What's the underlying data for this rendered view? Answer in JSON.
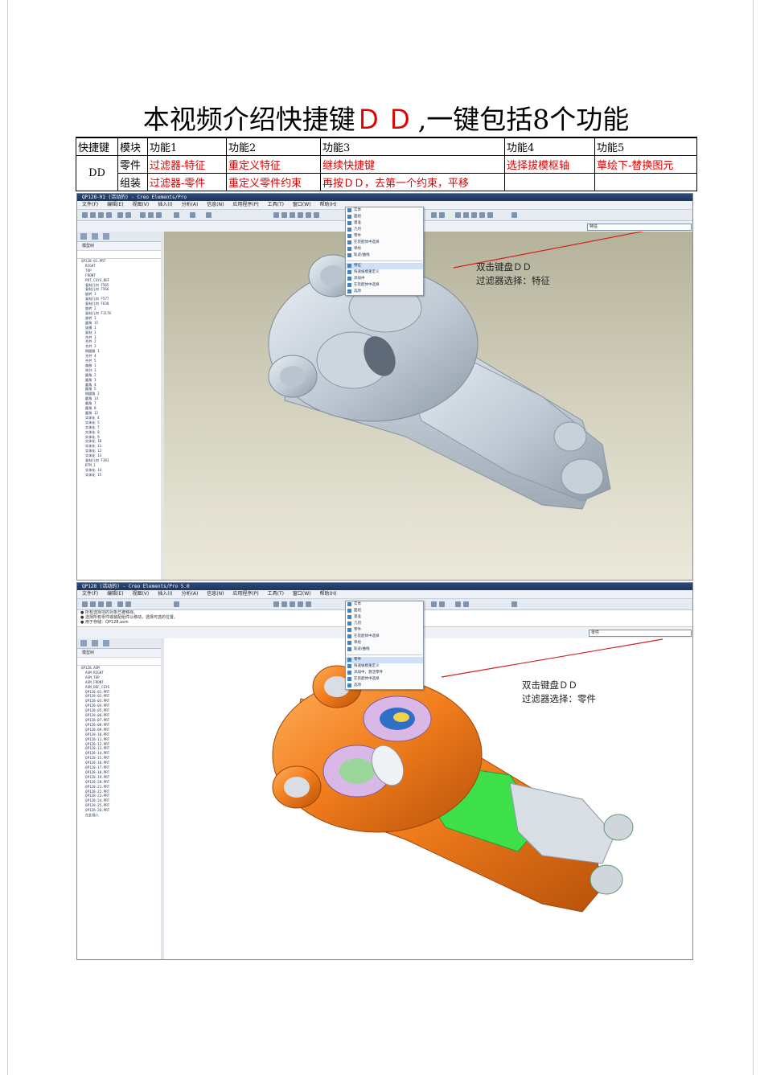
{
  "page": {
    "title_before": "本视频介绍快捷键",
    "title_dd": "ＤＤ",
    "title_after": ",一键包括8个功能"
  },
  "table": {
    "headers": [
      "快捷键",
      "模块",
      "功能1",
      "功能2",
      "功能3",
      "功能4",
      "功能5"
    ],
    "key": "DD",
    "rows": [
      {
        "module": "零件",
        "f1": "过滤器-特征",
        "f2": "重定义特征",
        "f3": "继续快捷键",
        "f4": "选择拔模枢轴",
        "f5": "草绘下-替换图元"
      },
      {
        "module": "组装",
        "f1": "过滤器-零件",
        "f2": "重定义零件约束",
        "f3": "再按ＤＤ，去第一个约束，平移",
        "f4": "",
        "f5": ""
      }
    ],
    "text_color": "#e00000"
  },
  "screenshot1": {
    "window_title": "QP128-01 (活动的) - Creo Elements/Pro",
    "menus": [
      "文件(F)",
      "编辑(E)",
      "视图(V)",
      "插入(I)",
      "分析(A)",
      "信息(N)",
      "应用程序(P)",
      "工具(T)",
      "窗口(W)",
      "帮助(H)"
    ],
    "filter_value": "特征",
    "tree_header": "模型树",
    "tree_root": "QP128-01.PRT",
    "tree_items": [
      "RIGHT",
      "TOP",
      "FRONT",
      "PRT_CSYS_DEF",
      "复制几何 F565",
      "复制几何 F566",
      "旋转 1",
      "复制几何 F577",
      "复制几何 F630",
      "旋转 2",
      "复制几何 F1178",
      "旋转 3",
      "圆角 15",
      "拔模 1",
      "复制 1",
      "合并 1",
      "合并 2",
      "合并 3",
      "倒圆角 1",
      "合并 4",
      "合并 5",
      "偏移 1",
      "阵列 1",
      "圆角 2",
      "圆角 3",
      "圆角 4",
      "圆角 5",
      "倒圆角 2",
      "圆角 14",
      "圆角 7",
      "圆角 8",
      "圆角 12",
      "实体化 4",
      "实体化 5",
      "实体化 7",
      "实体化 8",
      "实体化 9",
      "实体化 10",
      "实体化 11",
      "实体化 12",
      "实体化 13",
      "复制几何 F381",
      "DTM_1",
      "实体化 14",
      "实体化 15"
    ],
    "popup_items": [
      "实体",
      "面组",
      "基准",
      "几何",
      "零件",
      "在装配体中选择",
      "草绘",
      "轨迹/曲线",
      "特征",
      "快速拔模重定义",
      "添加中",
      "在装配体中选择",
      "选项"
    ],
    "popup_selected": "特征",
    "annotation_line1": "双击键盘ＤＤ",
    "annotation_line2": "过滤器选择：特征",
    "arrow_color": "#d22222",
    "viewport_bg": "#cfccb6",
    "model_color": "#c6d2dd"
  },
  "screenshot2": {
    "window_title": "QP128 (活动的) - Creo Elements/Pro 5.0",
    "menus": [
      "文件(F)",
      "编辑(E)",
      "视图(V)",
      "插入(I)",
      "分析(A)",
      "信息(N)",
      "应用程序(P)",
      "工具(T)",
      "窗口(W)",
      "帮助(H)"
    ],
    "status_line1": "● 所有选择项的对象已被移除。",
    "status_line2": "● 选择所有零件或装配组件以移动，选择可选的位置。",
    "status_line3": "● 用于存储：QP128.asm",
    "status_line4": "● 用于存储：QP128.asm",
    "filter_value": "零件",
    "tree_header": "模型树",
    "tree_root": "QP128.ASM",
    "tree_items": [
      "ASM_RIGHT",
      "ASM_TOP",
      "ASM_FRONT",
      "ASM_DEF_CSYS",
      "QP128-01.PRT",
      "QP128-02.PRT",
      "QP128-03.PRT",
      "QP128-04.PRT",
      "QP128-05.PRT",
      "QP128-06.PRT",
      "QP128-07.PRT",
      "QP128-08.PRT",
      "QP128-09.PRT",
      "QP128-10.PRT",
      "QP128-11.PRT",
      "QP128-12.PRT",
      "QP128-13.PRT",
      "QP128-14.PRT",
      "QP128-15.PRT",
      "QP128-16.PRT",
      "QP128-17.PRT",
      "QP128-18.PRT",
      "QP128-19.PRT",
      "QP128-20.PRT",
      "QP128-21.PRT",
      "QP128-22.PRT",
      "QP128-23.PRT",
      "QP128-24.PRT",
      "QP128-25.PRT",
      "QP128-26.PRT",
      "在此插入"
    ],
    "popup_items": [
      "实体",
      "面组",
      "基准",
      "几何",
      "零件",
      "在装配体中选择",
      "草绘",
      "轨迹/曲线",
      "零件",
      "快速拔模重定义",
      "添加中，激活零件",
      "在装配体中选择",
      "选项"
    ],
    "popup_selected": "零件",
    "annotation_line1": "双击键盘ＤＤ",
    "annotation_line2": "过滤器选择：零件",
    "arrow_color": "#d22222",
    "viewport_bg": "#ffffff",
    "body_color": "#f07c1c",
    "shirt_color": "#3ee04a",
    "pants_color": "#d8dee4"
  }
}
